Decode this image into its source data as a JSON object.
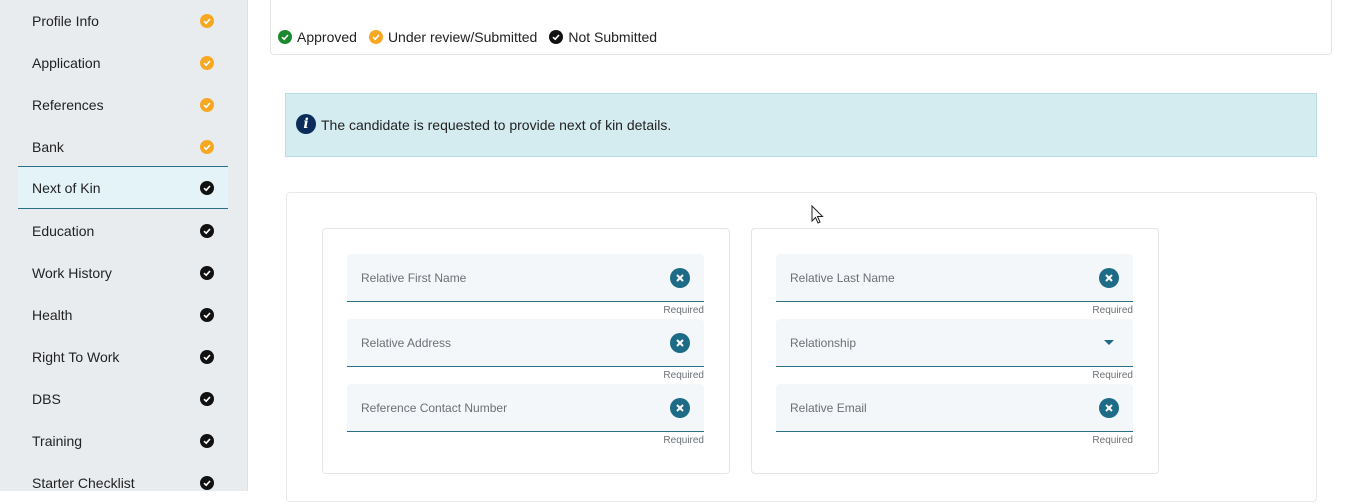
{
  "sidebar": {
    "items": [
      {
        "label": "Profile Info",
        "status": "under-review"
      },
      {
        "label": "Application",
        "status": "under-review"
      },
      {
        "label": "References",
        "status": "under-review"
      },
      {
        "label": "Bank",
        "status": "under-review"
      },
      {
        "label": "Next of Kin",
        "status": "not-submitted",
        "active": true
      },
      {
        "label": "Education",
        "status": "not-submitted"
      },
      {
        "label": "Work History",
        "status": "not-submitted"
      },
      {
        "label": "Health",
        "status": "not-submitted"
      },
      {
        "label": "Right To Work",
        "status": "not-submitted"
      },
      {
        "label": "DBS",
        "status": "not-submitted"
      },
      {
        "label": "Training",
        "status": "not-submitted"
      },
      {
        "label": "Starter Checklist",
        "status": "not-submitted"
      }
    ]
  },
  "legend": {
    "approved": "Approved",
    "under_review": "Under review/Submitted",
    "not_submitted": "Not Submitted"
  },
  "info": {
    "message": "The candidate is requested to provide next of kin details.",
    "icon": "info-icon"
  },
  "form": {
    "first_name": {
      "placeholder": "Relative First Name",
      "hint": "Required"
    },
    "last_name": {
      "placeholder": "Relative Last Name",
      "hint": "Required"
    },
    "address": {
      "placeholder": "Relative Address",
      "hint": "Required"
    },
    "relationship": {
      "placeholder": "Relationship",
      "hint": "Required"
    },
    "contact_number": {
      "placeholder": "Reference Contact Number",
      "hint": "Required"
    },
    "email": {
      "placeholder": "Relative Email",
      "hint": "Required"
    }
  },
  "colors": {
    "under_review": "#f6a823",
    "not_submitted": "#111111",
    "approved": "#1a8a2e",
    "accent": "#1d6b86",
    "info_bg": "#d4ebf0"
  }
}
